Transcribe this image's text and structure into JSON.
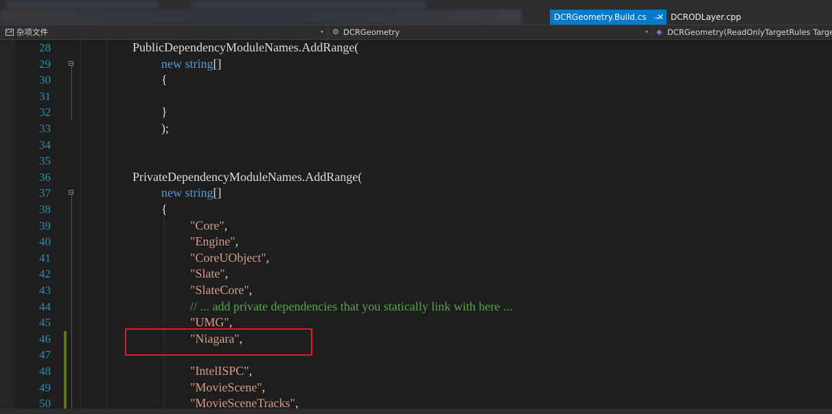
{
  "tabs": [
    {
      "label": "DCRGeometry.Build.cs",
      "pin": "⊸",
      "close": "✕",
      "active": true
    },
    {
      "label": "DCRODLayer.cpp",
      "active": false
    }
  ],
  "navbar": {
    "project": "杂项文件",
    "class": "DCRGeometry",
    "member": "DCRGeometry(ReadOnlyTargetRules Target",
    "dropdown_glyph": "▾"
  },
  "editor": {
    "lines": [
      {
        "n": "28"
      },
      {
        "n": "29"
      },
      {
        "n": "30"
      },
      {
        "n": "31"
      },
      {
        "n": "32"
      },
      {
        "n": "33"
      },
      {
        "n": "34"
      },
      {
        "n": "35"
      },
      {
        "n": "36"
      },
      {
        "n": "37"
      },
      {
        "n": "38"
      },
      {
        "n": "39"
      },
      {
        "n": "40"
      },
      {
        "n": "41"
      },
      {
        "n": "42"
      },
      {
        "n": "43"
      },
      {
        "n": "44"
      },
      {
        "n": "45"
      },
      {
        "n": "46"
      },
      {
        "n": "47"
      },
      {
        "n": "48"
      },
      {
        "n": "49"
      },
      {
        "n": "50"
      }
    ],
    "code": {
      "l28": "PublicDependencyModuleNames.AddRange(",
      "l29_kw1": "new",
      "l29_kw2": "string",
      "l29_rest": "[]",
      "l30": "{",
      "l32": "}",
      "l33": ");",
      "l36": "PrivateDependencyModuleNames.AddRange(",
      "l37_kw1": "new",
      "l37_kw2": "string",
      "l37_rest": "[]",
      "l38": "{",
      "l39_str": "\"Core\"",
      "l40_str": "\"Engine\"",
      "l41_str": "\"CoreUObject\"",
      "l42_str": "\"Slate\"",
      "l43_str": "\"SlateCore\"",
      "l44_comment": "// ... add private dependencies that you statically link with here ...",
      "l45_str": "\"UMG\"",
      "l46_str": "\"Niagara\"",
      "l48_str": "\"IntelISPC\"",
      "l49_str": "\"MovieScene\"",
      "l50_str": "\"MovieSceneTracks\"",
      "comma": ","
    }
  },
  "colors": {
    "keyword": "#569cd6",
    "string": "#d69d85",
    "comment": "#57a64a",
    "line_number": "#2b91af",
    "active_tab": "#007acc",
    "highlight_box": "#e21c22",
    "change_bar": "#587c0c"
  }
}
